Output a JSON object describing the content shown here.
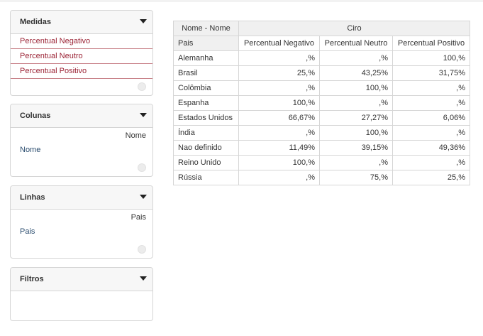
{
  "panels": {
    "medidas": {
      "title": "Medidas",
      "items": [
        "Percentual Negativo",
        "Percentual Neutro",
        "Percentual Positivo"
      ]
    },
    "colunas": {
      "title": "Colunas",
      "header": "Nome",
      "item": "Nome"
    },
    "linhas": {
      "title": "Linhas",
      "header": "Pais",
      "item": "Pais"
    },
    "filtros": {
      "title": "Filtros"
    }
  },
  "pivot": {
    "corner_label": "Nome - Nome",
    "group_label": "Ciro",
    "row_header": "Pais",
    "columns": [
      "Percentual Negativo",
      "Percentual Neutro",
      "Percentual Positivo"
    ],
    "rows": [
      {
        "label": "Alemanha",
        "values": [
          ",%",
          ",%",
          "100,%"
        ]
      },
      {
        "label": "Brasil",
        "values": [
          "25,%",
          "43,25%",
          "31,75%"
        ]
      },
      {
        "label": "Colômbia",
        "values": [
          ",%",
          "100,%",
          ",%"
        ]
      },
      {
        "label": "Espanha",
        "values": [
          "100,%",
          ",%",
          ",%"
        ]
      },
      {
        "label": "Estados Unidos",
        "values": [
          "66,67%",
          "27,27%",
          "6,06%"
        ]
      },
      {
        "label": "Índia",
        "values": [
          ",%",
          "100,%",
          ",%"
        ]
      },
      {
        "label": "Nao definido",
        "values": [
          "11,49%",
          "39,15%",
          "49,36%"
        ]
      },
      {
        "label": "Reino Unido",
        "values": [
          "100,%",
          ",%",
          ",%"
        ]
      },
      {
        "label": "Rússia",
        "values": [
          ",%",
          "75,%",
          "25,%"
        ]
      }
    ]
  }
}
